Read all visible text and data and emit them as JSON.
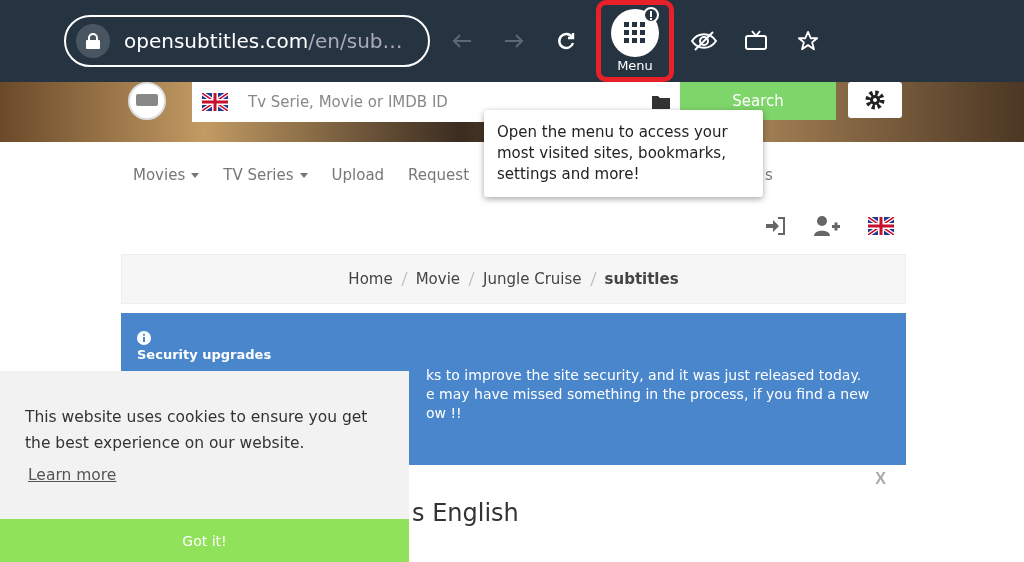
{
  "browser": {
    "url_host": "opensubtitles.com",
    "url_path": "/en/sub…",
    "menu_label": "Menu",
    "menu_highlighted": true
  },
  "tooltip": {
    "text": "Open the menu to access your most visited sites, bookmarks, settings and more!"
  },
  "search": {
    "placeholder": "Tv Serie, Movie or IMDB ID",
    "button": "Search"
  },
  "nav": [
    {
      "label": "Movies",
      "dropdown": true
    },
    {
      "label": "TV Series",
      "dropdown": true
    },
    {
      "label": "Upload",
      "dropdown": false
    },
    {
      "label": "Request",
      "dropdown": false
    }
  ],
  "nav_tail": "s",
  "breadcrumb": [
    {
      "label": "Home",
      "current": false
    },
    {
      "label": "Movie",
      "current": false
    },
    {
      "label": "Jungle Cruise",
      "current": false
    },
    {
      "label": "subtitles",
      "current": true
    }
  ],
  "banner": {
    "title": "Security upgrades",
    "lines": [
      "ks to improve the site security, and it was just released today.",
      "e may have missed something in the process, if you find a new",
      "ow !!"
    ],
    "close": "X"
  },
  "heading_tail": "s English",
  "cookie": {
    "text": "This website uses cookies to ensure you get the best experience on our website.",
    "link": "Learn more",
    "button": "Got it!"
  }
}
